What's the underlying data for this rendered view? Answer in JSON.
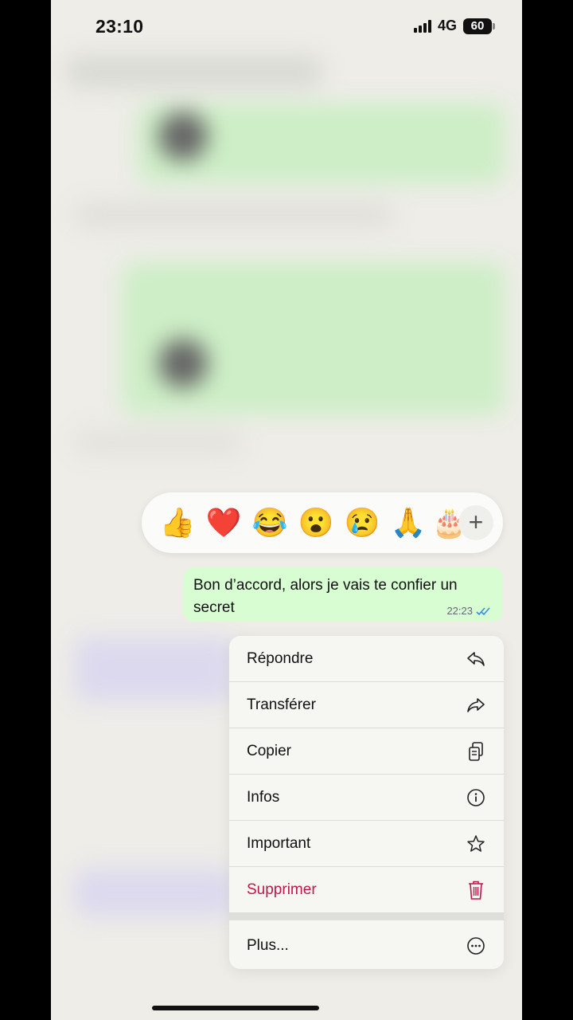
{
  "status_bar": {
    "time": "23:10",
    "network": "4G",
    "battery": "60"
  },
  "reactions": {
    "emojis": [
      "👍",
      "❤️",
      "😂",
      "😮",
      "😢",
      "🙏",
      "🎂"
    ],
    "more_label": "+"
  },
  "message": {
    "text": "Bon d’accord, alors je vais te confier un secret",
    "time": "22:23",
    "status": "read"
  },
  "menu": {
    "items": [
      {
        "label": "Répondre",
        "icon": "reply-icon"
      },
      {
        "label": "Transférer",
        "icon": "forward-icon"
      },
      {
        "label": "Copier",
        "icon": "copy-icon"
      },
      {
        "label": "Infos",
        "icon": "info-icon"
      },
      {
        "label": "Important",
        "icon": "star-icon"
      },
      {
        "label": "Supprimer",
        "icon": "trash-icon"
      }
    ],
    "more": {
      "label": "Plus...",
      "icon": "more-icon"
    }
  },
  "colors": {
    "outgoing_bubble": "#d8fdd2",
    "danger": "#c0174a",
    "read_ticks": "#3a8de0"
  }
}
